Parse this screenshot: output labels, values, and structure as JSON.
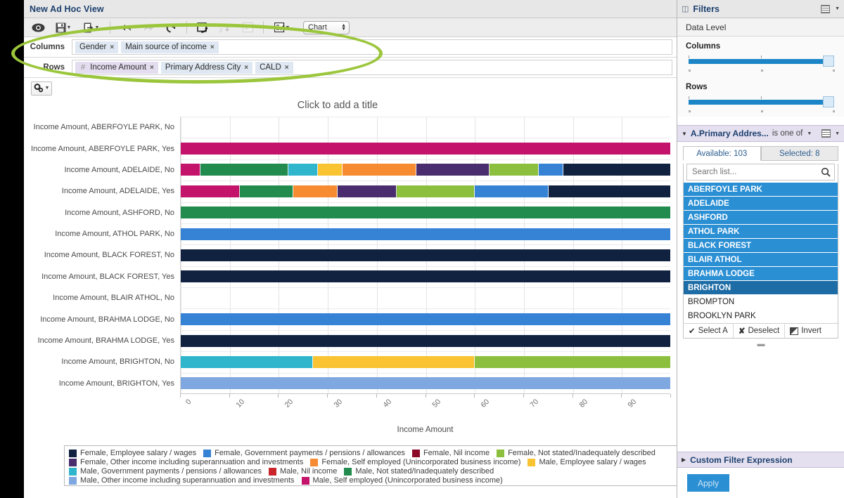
{
  "window": {
    "title": "New Ad Hoc View"
  },
  "toolbar": {
    "buttons": [
      {
        "name": "view-preview",
        "icon": "eye-icon",
        "label": ""
      },
      {
        "name": "save",
        "icon": "save-disk-icon",
        "label": ""
      },
      {
        "name": "export",
        "icon": "export-icon",
        "label": ""
      },
      {
        "name": "undo",
        "icon": "undo-arrow-icon",
        "label": ""
      },
      {
        "name": "redo",
        "icon": "redo-arrow-icon",
        "label": ""
      },
      {
        "name": "revert",
        "icon": "revert-icon",
        "label": ""
      },
      {
        "name": "switch-group",
        "icon": "switch-icon",
        "label": ""
      },
      {
        "name": "sort",
        "icon": "sort-az-icon",
        "label": ""
      },
      {
        "name": "page-options",
        "icon": "page-icon",
        "label": ""
      },
      {
        "name": "select-visualization",
        "icon": "checklist-icon",
        "label": ""
      }
    ],
    "chart_select": {
      "value": "Chart"
    }
  },
  "shelves": {
    "columns": {
      "label": "Columns",
      "fields": [
        {
          "name": "Gender",
          "type": "dimension"
        },
        {
          "name": "Main source of income",
          "type": "dimension"
        }
      ]
    },
    "rows": {
      "label": "Rows",
      "fields": [
        {
          "name": "Income Amount",
          "type": "measure",
          "prefix": "#"
        },
        {
          "name": "Primary Address City",
          "type": "dimension"
        },
        {
          "name": "CALD",
          "type": "dimension"
        }
      ]
    },
    "remove_glyph": "×"
  },
  "chart_header": {
    "gear_label": "",
    "title_placeholder": "Click to add a title"
  },
  "chart_data": {
    "type": "bar",
    "orientation": "horizontal",
    "stacked": true,
    "title": "Click to add a title",
    "xlabel": "Income Amount",
    "ylabel": "",
    "xlim": [
      0,
      100
    ],
    "xticks": [
      "0",
      "10",
      "20",
      "30",
      "40",
      "50",
      "60",
      "70",
      "80",
      "90",
      "100"
    ],
    "grid": true,
    "legend_position": "bottom",
    "categories": [
      "Income Amount, ABERFOYLE PARK, No",
      "Income Amount, ABERFOYLE PARK, Yes",
      "Income Amount, ADELAIDE, No",
      "Income Amount, ADELAIDE, Yes",
      "Income Amount, ASHFORD, No",
      "Income Amount, ATHOL PARK, No",
      "Income Amount, BLACK FOREST, No",
      "Income Amount, BLACK FOREST, Yes",
      "Income Amount, BLAIR ATHOL, No",
      "Income Amount, BRAHMA LODGE, No",
      "Income Amount, BRAHMA LODGE, Yes",
      "Income Amount, BRIGHTON, No",
      "Income Amount, BRIGHTON, Yes"
    ],
    "series": [
      {
        "name": "Female, Employee salary / wages",
        "color": "#112240"
      },
      {
        "name": "Female, Government payments / pensions / allowances",
        "color": "#3683d6"
      },
      {
        "name": "Female, Nil income",
        "color": "#8c0a27"
      },
      {
        "name": "Female, Not stated/Inadequately described",
        "color": "#8dbf3f"
      },
      {
        "name": "Female, Other income including superannuation and investments",
        "color": "#4a2d6e"
      },
      {
        "name": "Female, Self employed (Unincorporated business income)",
        "color": "#f68b31"
      },
      {
        "name": "Male, Employee salary / wages",
        "color": "#f9c332"
      },
      {
        "name": "Male, Government payments / pensions / allowances",
        "color": "#2fb5cc"
      },
      {
        "name": "Male, Nil income",
        "color": "#c9252b"
      },
      {
        "name": "Male, Not stated/Inadequately described",
        "color": "#228b4e"
      },
      {
        "name": "Male, Other income including superannuation and investments",
        "color": "#7fa8e0"
      },
      {
        "name": "Male, Self employed (Unincorporated business income)",
        "color": "#c4136b"
      }
    ],
    "bars": [
      {
        "category": "Income Amount, ABERFOYLE PARK, No",
        "segments": []
      },
      {
        "category": "Income Amount, ABERFOYLE PARK, Yes",
        "segments": [
          {
            "series": "Male, Self employed (Unincorporated business income)",
            "value": 100
          }
        ]
      },
      {
        "category": "Income Amount, ADELAIDE, No",
        "segments": [
          {
            "series": "Male, Self employed (Unincorporated business income)",
            "value": 4
          },
          {
            "series": "Male, Not stated/Inadequately described",
            "value": 18
          },
          {
            "series": "Male, Government payments / pensions / allowances",
            "value": 6
          },
          {
            "series": "Male, Employee salary / wages",
            "value": 5
          },
          {
            "series": "Female, Self employed (Unincorporated business income)",
            "value": 15
          },
          {
            "series": "Female, Other income including superannuation and investments",
            "value": 15
          },
          {
            "series": "Female, Not stated/Inadequately described",
            "value": 10
          },
          {
            "series": "Female, Government payments / pensions / allowances",
            "value": 5
          },
          {
            "series": "Female, Employee salary / wages",
            "value": 22
          }
        ]
      },
      {
        "category": "Income Amount, ADELAIDE, Yes",
        "segments": [
          {
            "series": "Male, Self employed (Unincorporated business income)",
            "value": 12
          },
          {
            "series": "Male, Not stated/Inadequately described",
            "value": 11
          },
          {
            "series": "Female, Self employed (Unincorporated business income)",
            "value": 9
          },
          {
            "series": "Female, Other income including superannuation and investments",
            "value": 12
          },
          {
            "series": "Female, Not stated/Inadequately described",
            "value": 16
          },
          {
            "series": "Female, Government payments / pensions / allowances",
            "value": 15
          },
          {
            "series": "Female, Employee salary / wages",
            "value": 25
          }
        ]
      },
      {
        "category": "Income Amount, ASHFORD, No",
        "segments": [
          {
            "series": "Male, Not stated/Inadequately described",
            "value": 100
          }
        ]
      },
      {
        "category": "Income Amount, ATHOL PARK, No",
        "segments": [
          {
            "series": "Female, Government payments / pensions / allowances",
            "value": 100
          }
        ]
      },
      {
        "category": "Income Amount, BLACK FOREST, No",
        "segments": [
          {
            "series": "Female, Employee salary / wages",
            "value": 100
          }
        ]
      },
      {
        "category": "Income Amount, BLACK FOREST, Yes",
        "segments": [
          {
            "series": "Female, Employee salary / wages",
            "value": 100
          }
        ]
      },
      {
        "category": "Income Amount, BLAIR ATHOL, No",
        "segments": []
      },
      {
        "category": "Income Amount, BRAHMA LODGE, No",
        "segments": [
          {
            "series": "Female, Government payments / pensions / allowances",
            "value": 100
          }
        ]
      },
      {
        "category": "Income Amount, BRAHMA LODGE, Yes",
        "segments": [
          {
            "series": "Female, Employee salary / wages",
            "value": 100
          }
        ]
      },
      {
        "category": "Income Amount, BRIGHTON, No",
        "segments": [
          {
            "series": "Male, Government payments / pensions / allowances",
            "value": 27
          },
          {
            "series": "Male, Employee salary / wages",
            "value": 33
          },
          {
            "series": "Female, Not stated/Inadequately described",
            "value": 40
          }
        ]
      },
      {
        "category": "Income Amount, BRIGHTON, Yes",
        "segments": [
          {
            "series": "Male, Other income including superannuation and investments",
            "value": 100
          }
        ]
      }
    ],
    "legend": [
      {
        "label": "Female, Employee salary / wages",
        "color": "#112240"
      },
      {
        "label": "Female, Government payments / pensions / allowances",
        "color": "#3683d6"
      },
      {
        "label": "Female, Nil income",
        "color": "#8c0a27"
      },
      {
        "label": "Female, Not stated/Inadequately described",
        "color": "#8dbf3f"
      },
      {
        "label": "Female, Other income including superannuation and investments",
        "color": "#4a2d6e"
      },
      {
        "label": "Female, Self employed (Unincorporated business income)",
        "color": "#f68b31"
      },
      {
        "label": "Male, Employee salary / wages",
        "color": "#f9c332"
      },
      {
        "label": "Male, Government payments / pensions / allowances",
        "color": "#2fb5cc"
      },
      {
        "label": "Male, Nil income",
        "color": "#c9252b"
      },
      {
        "label": "Male, Not stated/Inadequately described",
        "color": "#228b4e"
      },
      {
        "label": "Male, Other income including superannuation and investments",
        "color": "#7fa8e0"
      },
      {
        "label": "Male, Self employed (Unincorporated business income)",
        "color": "#c4136b"
      }
    ]
  },
  "filters_panel": {
    "title": "Filters",
    "data_level": "Data Level",
    "columns_slider": {
      "label": "Columns"
    },
    "rows_slider": {
      "label": "Rows"
    },
    "filter": {
      "name": "A.Primary Addres...",
      "operator": "is one of",
      "tabs": [
        {
          "label": "Available: 103",
          "active": true
        },
        {
          "label": "Selected: 8",
          "active": false
        }
      ],
      "search_placeholder": "Search list...",
      "options": [
        {
          "label": "ABERFOYLE PARK",
          "state": "selected"
        },
        {
          "label": "ADELAIDE",
          "state": "selected"
        },
        {
          "label": "ASHFORD",
          "state": "selected"
        },
        {
          "label": "ATHOL PARK",
          "state": "selected"
        },
        {
          "label": "BLACK FOREST",
          "state": "selected"
        },
        {
          "label": "BLAIR ATHOL",
          "state": "selected"
        },
        {
          "label": "BRAHMA LODGE",
          "state": "selected"
        },
        {
          "label": "BRIGHTON",
          "state": "highlighted"
        },
        {
          "label": "BROMPTON",
          "state": "none"
        },
        {
          "label": "BROOKLYN PARK",
          "state": "none"
        }
      ],
      "actions": [
        {
          "label": "Select A",
          "icon": "check-icon"
        },
        {
          "label": "Deselect",
          "icon": "x-icon"
        },
        {
          "label": "Invert",
          "icon": "invert-icon"
        }
      ]
    },
    "custom_filter_expression": "Custom Filter Expression",
    "apply_button": "Apply"
  },
  "colors": {
    "accent_blue": "#2b8fd4",
    "header_text": "#1c3f6e",
    "annotation_green": "#9bc63c",
    "filter_header_bg": "#e4e0ef"
  }
}
